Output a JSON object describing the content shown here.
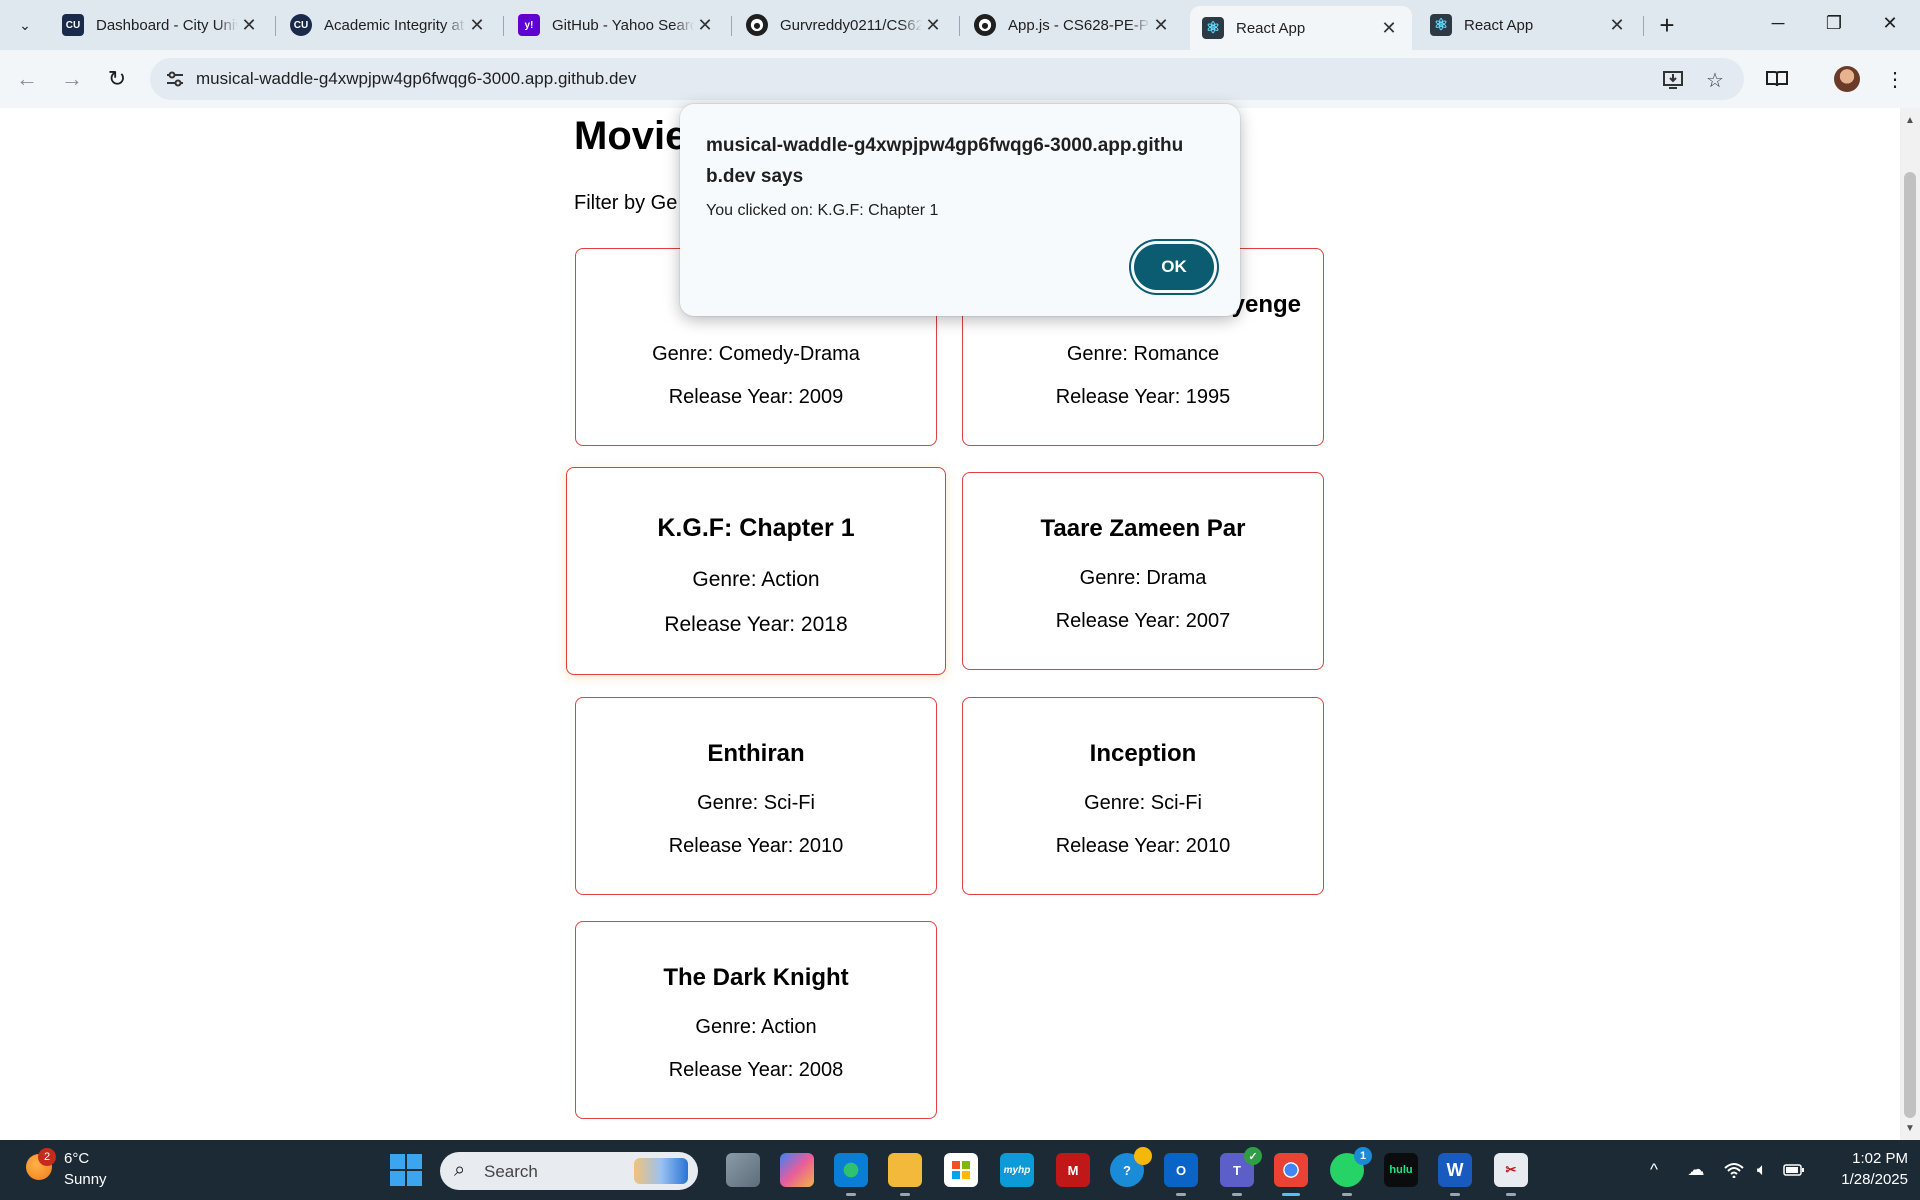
{
  "browser": {
    "tabs": [
      {
        "title": "Dashboard - City Univ",
        "favicon_text": "CU",
        "favicon_color": "#1a2a4a",
        "active": false
      },
      {
        "title": "Academic Integrity at",
        "favicon_text": "CU",
        "favicon_color": "#1a2a4a",
        "active": false
      },
      {
        "title": "GitHub - Yahoo Search",
        "favicon_text": "y!",
        "favicon_color": "#5f01d1",
        "active": false
      },
      {
        "title": "Gurvreddy0211/CS62",
        "favicon_text": "",
        "favicon_color": "#1f1f1f",
        "active": false
      },
      {
        "title": "App.js - CS628-PE-Pa",
        "favicon_text": "",
        "favicon_color": "#1f1f1f",
        "active": false
      },
      {
        "title": "React App",
        "favicon_text": "⚛",
        "favicon_color": "#2b3a44",
        "active": true
      },
      {
        "title": "React App",
        "favicon_text": "⚛",
        "favicon_color": "#2b3a44",
        "active": false
      }
    ],
    "url": "musical-waddle-g4xwpjpw4gp6fwqg6-3000.app.github.dev"
  },
  "page": {
    "title": "Movie",
    "filter_label": "Filter by Ge",
    "movies": [
      {
        "title": "",
        "genre": "Genre: Comedy-Drama",
        "year": "Release Year: 2009"
      },
      {
        "title": "yenge",
        "genre": "Genre: Romance",
        "year": "Release Year: 1995"
      },
      {
        "title": "K.G.F: Chapter 1",
        "genre": "Genre: Action",
        "year": "Release Year: 2018"
      },
      {
        "title": "Taare Zameen Par",
        "genre": "Genre: Drama",
        "year": "Release Year: 2007"
      },
      {
        "title": "Enthiran",
        "genre": "Genre: Sci-Fi",
        "year": "Release Year: 2010"
      },
      {
        "title": "Inception",
        "genre": "Genre: Sci-Fi",
        "year": "Release Year: 2010"
      },
      {
        "title": "The Dark Knight",
        "genre": "Genre: Action",
        "year": "Release Year: 2008"
      }
    ]
  },
  "dialog": {
    "title": "musical-waddle-g4xwpjpw4gp6fwqg6-3000.app.github.dev says",
    "message": "You clicked on: K.G.F: Chapter 1",
    "ok_label": "OK"
  },
  "taskbar": {
    "weather_badge": "2",
    "temperature": "6°C",
    "condition": "Sunny",
    "search_placeholder": "Search",
    "hulu_label": "hulu",
    "word_label": "W",
    "whatsapp_badge": "1",
    "time": "1:02 PM",
    "date": "1/28/2025"
  }
}
